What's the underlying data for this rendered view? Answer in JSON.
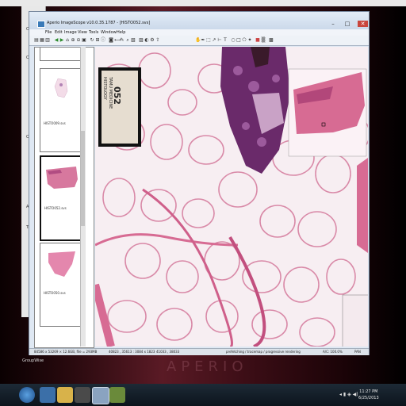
{
  "window": {
    "title": "Aperio ImageScope v10.0.35.1787 - [HISTO052.svs]",
    "menu": [
      "File",
      "Edit",
      "Image",
      "View",
      "Tools",
      "Window",
      "Help"
    ]
  },
  "thumbnails": [
    {
      "caption": "HISTO009.svs"
    },
    {
      "caption": "HISTO052.svs"
    },
    {
      "caption": "HISTO050.svs"
    }
  ],
  "label": {
    "number": "052",
    "line1": "TAMU MEDICINE",
    "line2": "HISTOLOGY"
  },
  "status": {
    "dims": "84586 x 53269 × 12.6GB, file = 293MB",
    "coords1": "40823 , 35613 : 3084 x 1823",
    "coords2": "41033 , 38033",
    "progress": "prefetching / tracemap / progressive rendering",
    "zoom": "A/C: 100.0%",
    "mode": "PAN"
  },
  "watermark": "APERIO",
  "taskbar": {
    "time": "11:27 PM",
    "date": "6/25/2013"
  },
  "desktop": {
    "groupwise": "GroupWise"
  },
  "background_window": {
    "labels": [
      "O",
      "Or",
      "Or",
      "Ac",
      "Tr"
    ]
  },
  "colors": {
    "tissue_pink": "#d76b93",
    "tissue_purple": "#6a2a6a",
    "accent": "#c9463d"
  }
}
